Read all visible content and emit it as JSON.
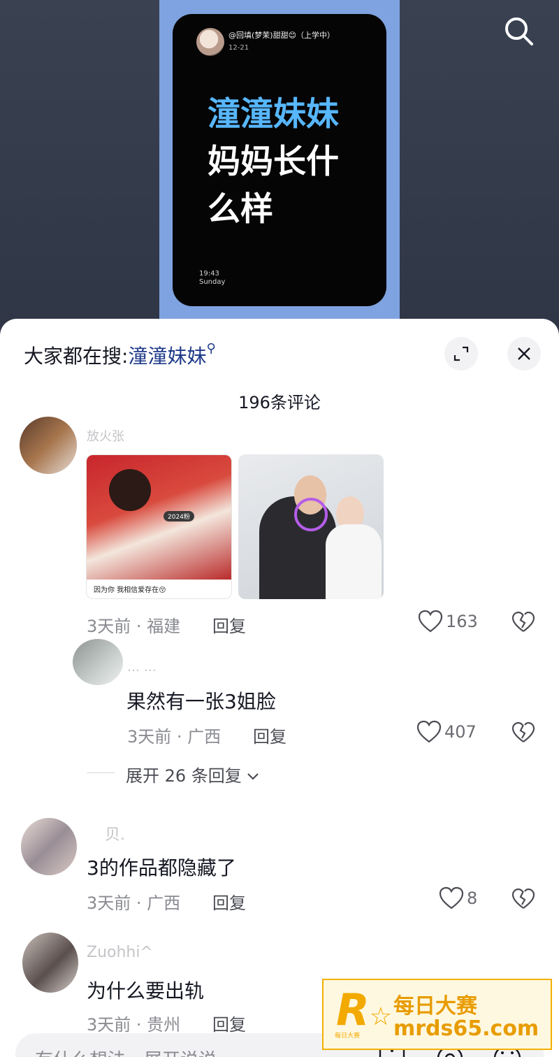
{
  "video": {
    "card": {
      "username": "@回填(梦茉)甜甜😊（上学中）",
      "date": "12-21",
      "title_highlight": "潼潼妹妹",
      "title_rest_line1": "妈妈长什",
      "title_rest_line2": "么样",
      "time": "19:43",
      "weekday": "Sunday"
    },
    "search_icon": "search-icon"
  },
  "sheet": {
    "hot_search_prefix": "大家都在搜:",
    "hot_search_keyword": "潼潼妹妹",
    "comment_count": "196条评论",
    "expand_icon": "expand-icon",
    "close_icon": "close-icon"
  },
  "comments": [
    {
      "username": "放火张",
      "photo1_caption": "因为你 我相信爱存在😚",
      "photo1_badge": "2024粉",
      "meta": "3天前 · 福建",
      "reply_label": "回复",
      "likes": "163"
    },
    {
      "username": "… …",
      "text": "果然有一张3姐脸",
      "meta": "3天前 · 广西",
      "reply_label": "回复",
      "likes": "407",
      "expand_label": "展开 26 条回复"
    },
    {
      "username": "贝.",
      "text": "3的作品都隐藏了",
      "meta": "3天前 · 广西",
      "reply_label": "回复",
      "likes": "8"
    },
    {
      "username": "Zuohhi^",
      "text": "为什么要出轨",
      "meta": "3天前 · 贵州",
      "reply_label": "回复"
    }
  ],
  "watermark": {
    "title": "每日大赛",
    "url": "mrds65.com",
    "small": "每日大赛"
  },
  "input": {
    "placeholder": "有什么想法，展开说说"
  },
  "colors": {
    "accent_keyword": "#1f3a8a",
    "card_highlight": "#57b7ff",
    "watermark": "#f2a900"
  }
}
